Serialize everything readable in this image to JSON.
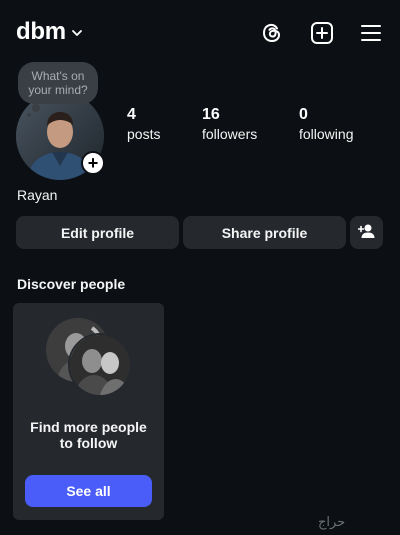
{
  "header": {
    "username": "dbm",
    "icons": [
      "chevron-down-icon",
      "threads-icon",
      "create-plus-icon",
      "hamburger-menu-icon"
    ]
  },
  "profile": {
    "note_line1": "What's on",
    "note_line2": "your mind?",
    "add_story_symbol": "+",
    "stats": {
      "posts_count": "4",
      "posts_label": "posts",
      "followers_count": "16",
      "followers_label": "followers",
      "following_count": "0",
      "following_label": "following"
    },
    "display_name": "Rayan"
  },
  "actions": {
    "edit_profile": "Edit profile",
    "share_profile": "Share profile"
  },
  "discover": {
    "title": "Discover people",
    "card_line1": "Find more people",
    "card_line2": "to follow",
    "see_all": "See all"
  },
  "watermark": "حراج",
  "colors": {
    "background": "#0c1014",
    "button_bg": "#25292e",
    "accent": "#4a5df9",
    "text": "#f5f5f5"
  }
}
